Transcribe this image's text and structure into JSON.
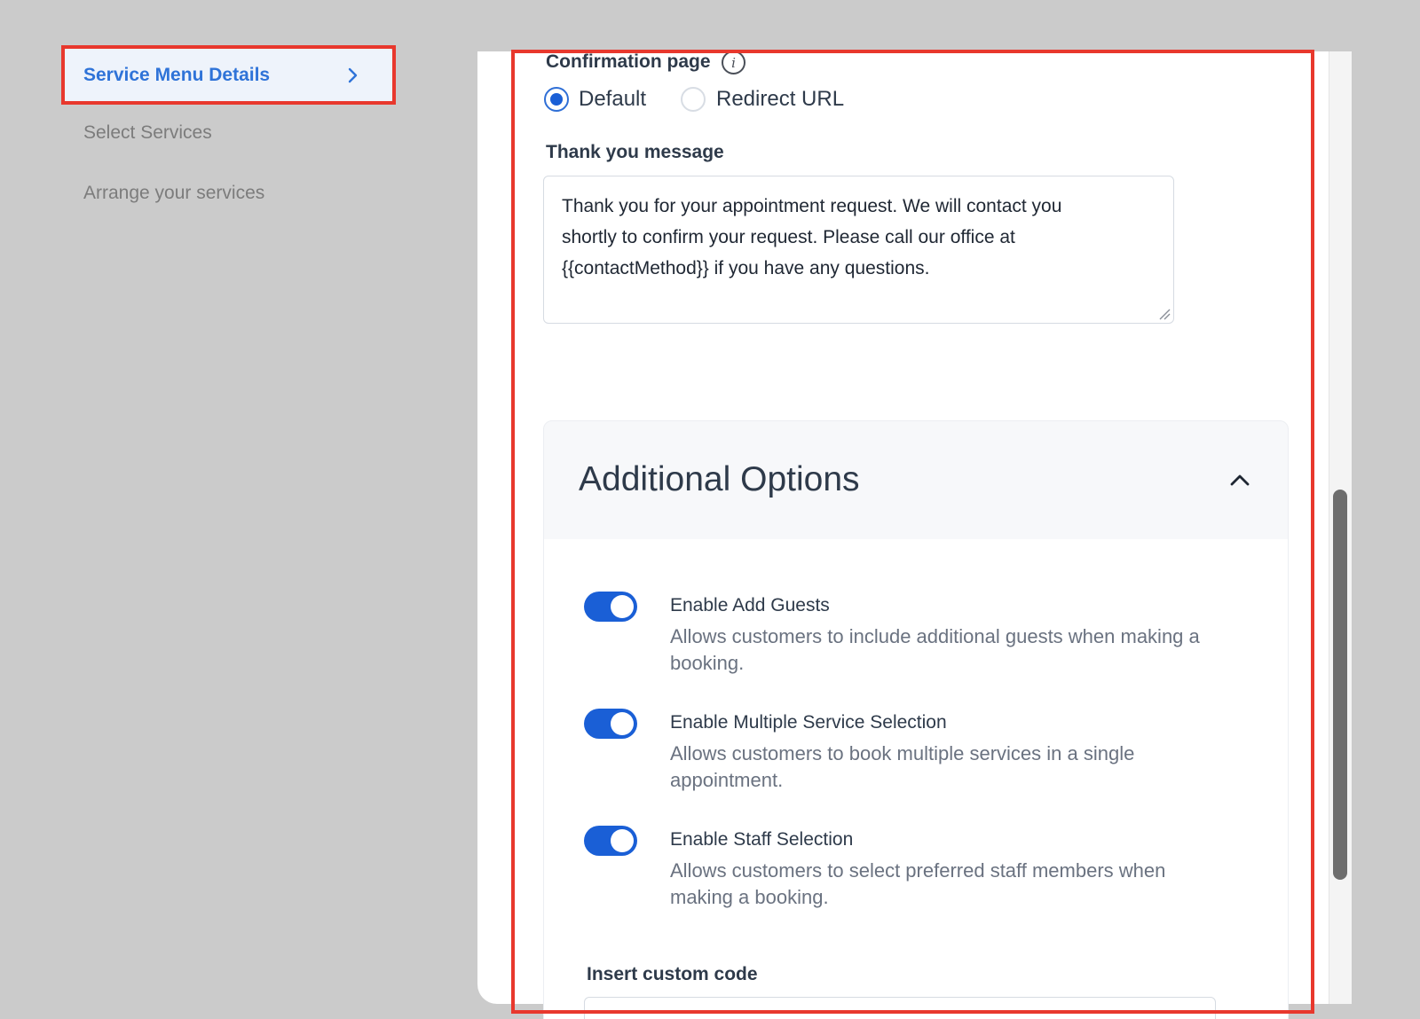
{
  "nav": {
    "items": [
      {
        "label": "Service Menu Details",
        "active": true
      },
      {
        "label": "Select Services",
        "active": false
      },
      {
        "label": "Arrange your services",
        "active": false
      }
    ]
  },
  "confirmation": {
    "label": "Confirmation page",
    "info_icon": "info-icon",
    "options": [
      {
        "label": "Default",
        "selected": true
      },
      {
        "label": "Redirect URL",
        "selected": false
      }
    ]
  },
  "thank_you": {
    "label": "Thank you message",
    "lines": [
      "Thank you for your appointment request. We will contact you",
      "shortly to confirm your request. Please call our office at",
      "{{contactMethod}} if you have any questions."
    ]
  },
  "additional_options": {
    "title": "Additional Options",
    "expanded": true,
    "collapse_icon": "chevron-up-icon",
    "items": [
      {
        "title": "Enable Add Guests",
        "desc_lines": [
          "Allows customers to include additional guests when making a",
          "booking."
        ],
        "enabled": true
      },
      {
        "title": "Enable Multiple Service Selection",
        "desc_lines": [
          "Allows customers to book multiple services in a single",
          "appointment."
        ],
        "enabled": true
      },
      {
        "title": "Enable Staff Selection",
        "desc_lines": [
          "Allows customers to select preferred staff members when",
          "making a booking."
        ],
        "enabled": true
      }
    ],
    "custom_code_label": "Insert custom code"
  },
  "colors": {
    "accent": "#1a5fd6",
    "nav_active": "#2f73d8",
    "annotation": "#e8382d"
  }
}
